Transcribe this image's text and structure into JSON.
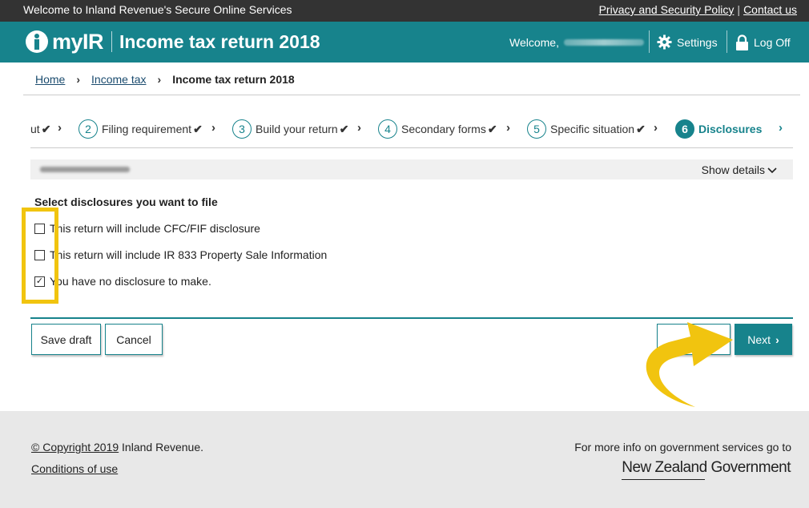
{
  "topbar": {
    "welcome_text": "Welcome to Inland Revenue's Secure Online Services",
    "privacy_link": "Privacy and Security Policy",
    "separator": "|",
    "contact_link": "Contact us"
  },
  "header": {
    "logo_text": "myIR",
    "page_title": "Income tax return 2018",
    "welcome_label": "Welcome,",
    "settings_label": "Settings",
    "logoff_label": "Log Off"
  },
  "breadcrumb": {
    "home": "Home",
    "income_tax": "Income tax",
    "current": "Income tax return 2018"
  },
  "steps": [
    {
      "number": "",
      "label": "ut",
      "completed": true
    },
    {
      "number": "2",
      "label": "Filing requirement",
      "completed": true
    },
    {
      "number": "3",
      "label": "Build your return",
      "completed": true
    },
    {
      "number": "4",
      "label": "Secondary forms",
      "completed": true
    },
    {
      "number": "5",
      "label": "Specific situation",
      "completed": true
    },
    {
      "number": "6",
      "label": "Disclosures",
      "completed": false,
      "active": true
    }
  ],
  "infobar": {
    "show_details": "Show details"
  },
  "disclosures": {
    "title": "Select disclosures you want to file",
    "options": [
      {
        "label": "This return will include CFC/FIF disclosure",
        "checked": false
      },
      {
        "label": "This return will include IR 833 Property Sale Information",
        "checked": false
      },
      {
        "label": "You have no disclosure to make.",
        "checked": true
      }
    ]
  },
  "actions": {
    "save_draft": "Save draft",
    "cancel": "Cancel",
    "back": "",
    "next": "Next"
  },
  "footer": {
    "copyright_link": "© Copyright 2019",
    "copyright_rest": " Inland Revenue.",
    "conditions": "Conditions of use",
    "more_info": "For more info on government services go to",
    "nz_government": "New Zealand Government"
  },
  "colors": {
    "teal": "#17838c",
    "topbar": "#333333",
    "highlight": "#f1c40f"
  }
}
